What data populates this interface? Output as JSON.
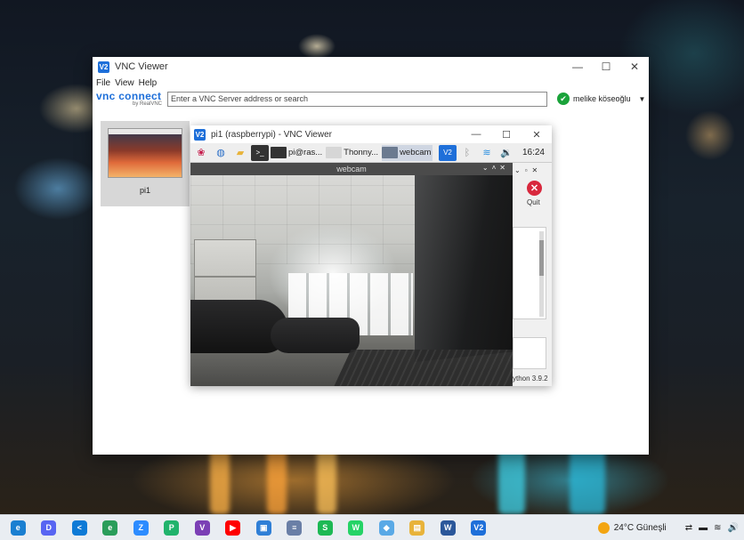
{
  "vnc_viewer": {
    "title": "VNC Viewer",
    "menu": [
      "File",
      "View",
      "Help"
    ],
    "brand_main": "vnc connect",
    "brand_sub": "by RealVNC",
    "search_placeholder": "Enter a VNC Server address or search",
    "user_name": "melike köseoğlu",
    "window_controls": {
      "minimize": "—",
      "maximize": "☐",
      "close": "✕"
    }
  },
  "server_card": {
    "name": "pi1"
  },
  "pi_session": {
    "title": "pi1 (raspberrypi) - VNC Viewer",
    "taskbar": {
      "buttons": [
        {
          "label": "pi@ras..."
        },
        {
          "label": "Thonny..."
        },
        {
          "label": "webcam"
        }
      ],
      "clock": "16:24"
    },
    "webcam_window": {
      "title": "webcam"
    },
    "thonny": {
      "quit_label": "Quit",
      "python_version": "ython 3.9.2"
    }
  },
  "win_taskbar": {
    "apps": [
      {
        "icon": "edge-icon",
        "color": "#1a7fd1",
        "glyph": "e"
      },
      {
        "icon": "discord-icon",
        "color": "#5865f2",
        "glyph": "D"
      },
      {
        "icon": "vscode-icon",
        "color": "#0e7ad6",
        "glyph": "<"
      },
      {
        "icon": "edge-dev-icon",
        "color": "#2a9d5a",
        "glyph": "e"
      },
      {
        "icon": "zoom-icon",
        "color": "#2d8cff",
        "glyph": "Z"
      },
      {
        "icon": "pycharm-icon",
        "color": "#21b36c",
        "glyph": "P"
      },
      {
        "icon": "visual-studio-icon",
        "color": "#7b3fb5",
        "glyph": "V"
      },
      {
        "icon": "youtube-icon",
        "color": "#ff0000",
        "glyph": "▶"
      },
      {
        "icon": "photos-icon",
        "color": "#2f7fd6",
        "glyph": "▣"
      },
      {
        "icon": "notepad-icon",
        "color": "#6a7fa6",
        "glyph": "≡"
      },
      {
        "icon": "spotify-icon",
        "color": "#1db954",
        "glyph": "S"
      },
      {
        "icon": "whatsapp-icon",
        "color": "#25d366",
        "glyph": "W"
      },
      {
        "icon": "files-icon",
        "color": "#5aa9e6",
        "glyph": "◆"
      },
      {
        "icon": "explorer-icon",
        "color": "#e8b33a",
        "glyph": "▤"
      },
      {
        "icon": "word-icon",
        "color": "#2b579a",
        "glyph": "W"
      },
      {
        "icon": "vnc-viewer-icon",
        "color": "#1e6fd9",
        "glyph": "V2"
      }
    ],
    "weather": "24°C  Güneşli",
    "tray_icons": [
      "⇄",
      "▬",
      "≋",
      "🔊"
    ]
  },
  "colors": {
    "vnc_blue": "#1e6fd9",
    "status_green": "#1aa33a",
    "quit_red": "#d8283d"
  }
}
